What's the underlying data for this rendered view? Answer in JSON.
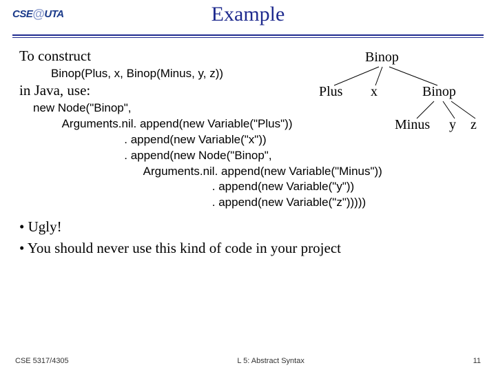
{
  "logo": {
    "left": "CSE",
    "at": "@",
    "right": "UTA"
  },
  "title": "Example",
  "body": {
    "to_construct": "To construct",
    "expression": "Binop(Plus, x, Binop(Minus, y, z))",
    "in_java": "in Java, use:",
    "code": "new Node(\"Binop\",\n         Arguments.nil. append(new Variable(\"Plus\"))\n                            . append(new Variable(\"x\"))\n                            . append(new Node(\"Binop\",\n                                  Arguments.nil. append(new Variable(\"Minus\"))\n                                                       . append(new Variable(\"y\"))\n                                                       . append(new Variable(\"z\")))))"
  },
  "bullets": [
    "Ugly!",
    "You should never use this kind of code in your project"
  ],
  "tree": {
    "root": "Binop",
    "c1": "Plus",
    "c2": "x",
    "c3": "Binop",
    "g1": "Minus",
    "g2": "y",
    "g3": "z"
  },
  "footer": {
    "left": "CSE 5317/4305",
    "center": "L 5: Abstract Syntax",
    "right": "11"
  }
}
